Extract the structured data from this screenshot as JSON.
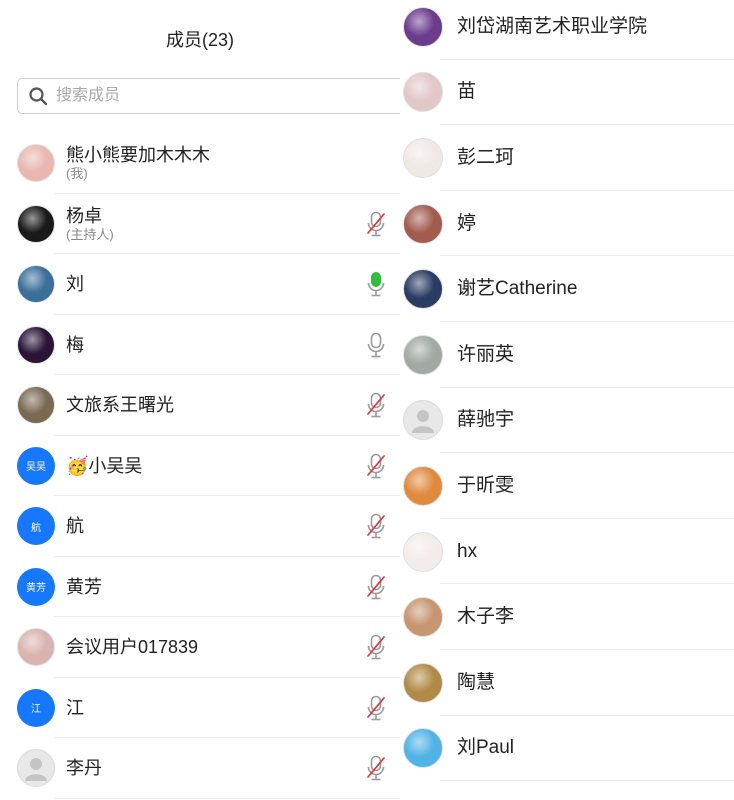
{
  "header": {
    "title": "成员(23)"
  },
  "search": {
    "placeholder": "搜索成员"
  },
  "members_left": [
    {
      "name": "熊小熊要加木木木",
      "sub": "(我)",
      "avatar": "photo-avatar",
      "avatar_color": "#e9b7b0",
      "mic": "none"
    },
    {
      "name": "杨卓",
      "sub": "(主持人)",
      "avatar": "photo-avatar",
      "avatar_color": "#1a1a1a",
      "mic": "muted"
    },
    {
      "name": "刘",
      "sub": "",
      "avatar": "photo-avatar",
      "avatar_color": "#3a6f9a",
      "mic": "active"
    },
    {
      "name": "梅",
      "sub": "",
      "avatar": "photo-avatar",
      "avatar_color": "#2a1536",
      "mic": "on"
    },
    {
      "name": "文旅系王曙光",
      "sub": "",
      "avatar": "photo-avatar",
      "avatar_color": "#7a6a52",
      "mic": "muted"
    },
    {
      "name": "🥳小吴吴",
      "sub": "",
      "avatar": "initials-avatar",
      "initials": "吴吴",
      "mic": "muted"
    },
    {
      "name": "航",
      "sub": "",
      "avatar": "initials-avatar",
      "initials": "航",
      "mic": "muted"
    },
    {
      "name": "黄芳",
      "sub": "",
      "avatar": "initials-avatar",
      "initials": "黄芳",
      "mic": "muted"
    },
    {
      "name": "会议用户017839",
      "sub": "",
      "avatar": "photo-avatar",
      "avatar_color": "#d9b3ae",
      "mic": "muted"
    },
    {
      "name": "江",
      "sub": "",
      "avatar": "initials-avatar",
      "initials": "江",
      "mic": "muted"
    },
    {
      "name": "李丹",
      "sub": "",
      "avatar": "default-avatar",
      "mic": "muted"
    }
  ],
  "members_right": [
    {
      "name": "刘岱湖南艺术职业学院",
      "avatar": "photo-avatar",
      "avatar_color": "#6b3b8d"
    },
    {
      "name": "苗",
      "avatar": "photo-avatar",
      "avatar_color": "#e2c7c9"
    },
    {
      "name": "彭二珂",
      "avatar": "photo-avatar",
      "avatar_color": "#efe9e6"
    },
    {
      "name": "婷",
      "avatar": "photo-avatar",
      "avatar_color": "#a25b4e"
    },
    {
      "name": "谢艺Catherine",
      "avatar": "photo-avatar",
      "avatar_color": "#2b3c63"
    },
    {
      "name": "许丽英",
      "avatar": "photo-avatar",
      "avatar_color": "#a2a8a4"
    },
    {
      "name": "薛驰宇",
      "avatar": "default-avatar"
    },
    {
      "name": "于昕雯",
      "avatar": "photo-avatar",
      "avatar_color": "#e08a3e"
    },
    {
      "name": "hx",
      "avatar": "photo-avatar",
      "avatar_color": "#f3ecea"
    },
    {
      "name": "木子李",
      "avatar": "photo-avatar",
      "avatar_color": "#c7956f"
    },
    {
      "name": "陶慧",
      "avatar": "photo-avatar",
      "avatar_color": "#b08b46"
    },
    {
      "name": "刘Paul",
      "avatar": "photo-avatar",
      "avatar_color": "#4fb3e6"
    }
  ],
  "colors": {
    "accent_blue": "#1677ff",
    "mic_active": "#2fbf3a",
    "mic_muted_slash": "#e0373b",
    "mic_grey": "#9a9a9a"
  }
}
